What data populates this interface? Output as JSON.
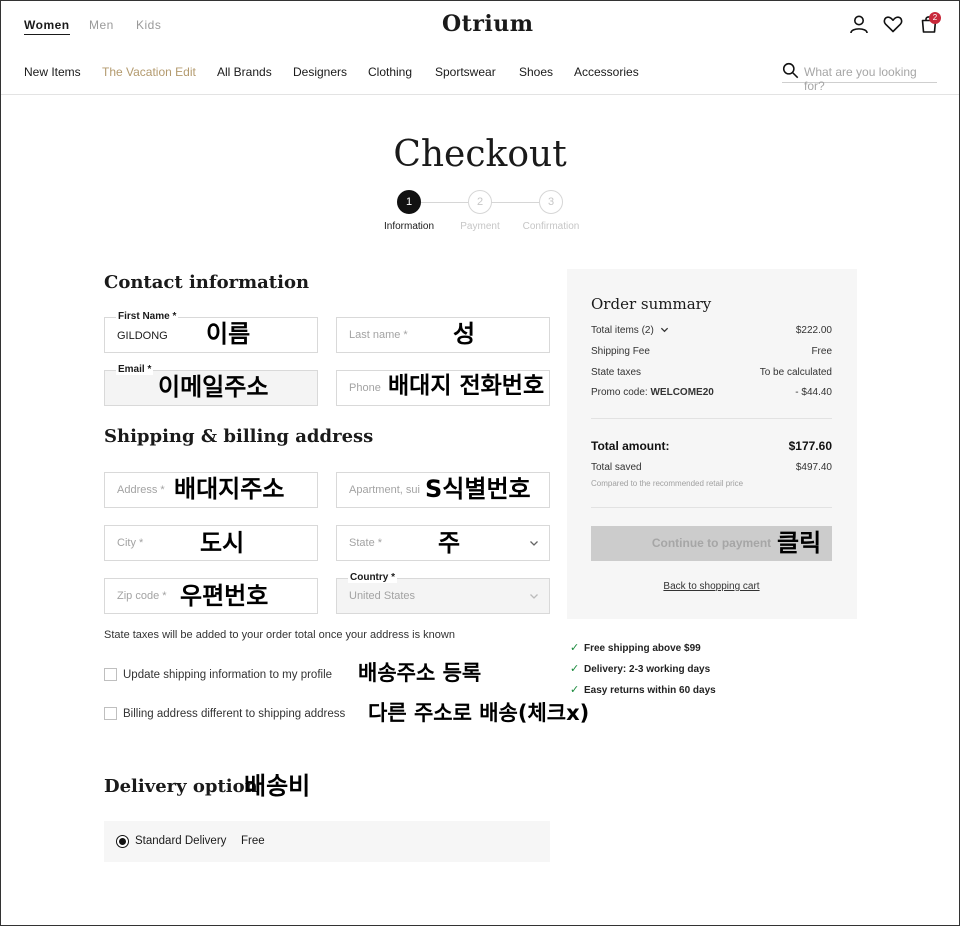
{
  "header": {
    "genders": [
      "Women",
      "Men",
      "Kids"
    ],
    "logo": "Otrium",
    "nav": [
      "New Items",
      "The Vacation Edit",
      "All Brands",
      "Designers",
      "Clothing",
      "Sportswear",
      "Shoes",
      "Accessories"
    ],
    "search_placeholder": "What are you looking for?",
    "cart_count": "2"
  },
  "checkout": {
    "title": "Checkout",
    "steps": [
      {
        "num": "1",
        "label": "Information"
      },
      {
        "num": "2",
        "label": "Payment"
      },
      {
        "num": "3",
        "label": "Confirmation"
      }
    ]
  },
  "contact": {
    "title": "Contact information",
    "first_name_label": "First Name *",
    "first_name_value": "GILDONG",
    "last_name_placeholder": "Last name *",
    "email_label": "Email *",
    "phone_placeholder": "Phone"
  },
  "shipping": {
    "title": "Shipping & billing address",
    "address_placeholder": "Address *",
    "apartment_placeholder": "Apartment, sui",
    "city_placeholder": "City *",
    "state_placeholder": "State *",
    "zip_placeholder": "Zip code *",
    "country_label": "Country *",
    "country_value": "United States",
    "tax_note": "State taxes will be added to your order total once your address is known",
    "checkbox_update": "Update shipping information to my profile",
    "checkbox_billing": "Billing address different to shipping address"
  },
  "delivery": {
    "title": "Delivery option",
    "option_label": "Standard Delivery",
    "option_price": "Free"
  },
  "summary": {
    "title": "Order summary",
    "rows": [
      {
        "label": "Total items (2)",
        "value": "$222.00"
      },
      {
        "label": "Shipping Fee",
        "value": "Free"
      },
      {
        "label": "State taxes",
        "value": "To be calculated"
      },
      {
        "label": "Promo code:",
        "code": "WELCOME20",
        "value": "- $44.40"
      }
    ],
    "total_label": "Total amount:",
    "total_value": "$177.60",
    "saved_label": "Total saved",
    "saved_value": "$497.40",
    "saved_note": "Compared to the recommended retail price",
    "cta_label": "Continue to payment",
    "back_label": "Back to shopping cart"
  },
  "perks": [
    "Free shipping above $99",
    "Delivery: 2-3 working days",
    "Easy returns within 60 days"
  ],
  "annotations": {
    "first_name": "이름",
    "last_name": "성",
    "email": "이메일주소",
    "phone": "배대지 전화번호",
    "address": "배대지주소",
    "apartment": "S식별번호",
    "city": "도시",
    "state": "주",
    "zip": "우편번호",
    "update_profile": "배송주소 등록",
    "billing": "다른 주소로 배송(체크x)",
    "delivery": "배송비",
    "cta": "클릭"
  },
  "colors": {
    "accent_nav": "#b39a6e",
    "badge": "#c8283a",
    "check": "#1a8a3c"
  }
}
